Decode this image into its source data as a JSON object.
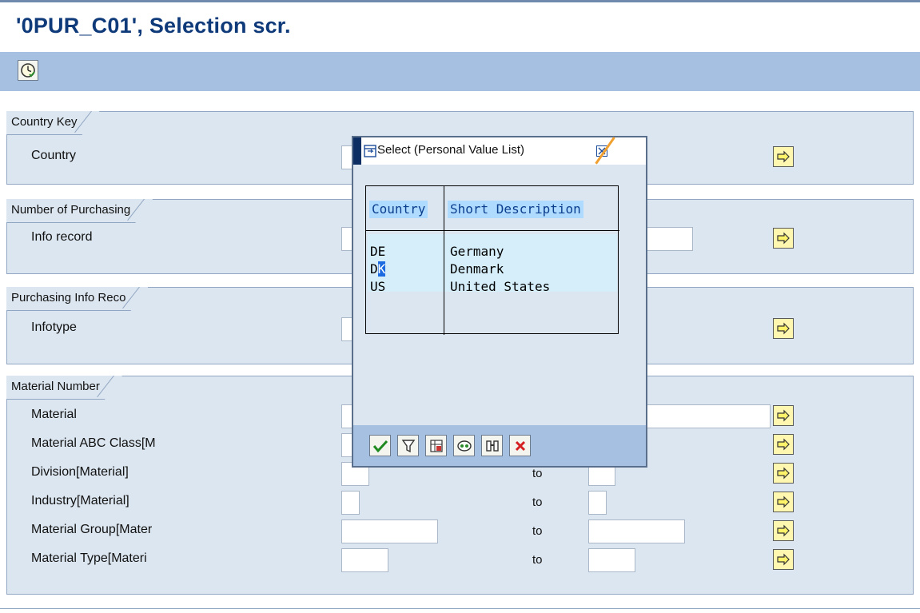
{
  "window": {
    "title": "'0PUR_C01', Selection scr."
  },
  "toolbar": {
    "execute_icon": "clock-execute-icon"
  },
  "groups": [
    {
      "title": "Country Key",
      "rows": [
        {
          "label": "Country",
          "to": ""
        }
      ]
    },
    {
      "title": "Number of Purchasing",
      "rows": [
        {
          "label": "Info record",
          "to": ""
        }
      ]
    },
    {
      "title": "Purchasing Info Reco",
      "rows": [
        {
          "label": "Infotype",
          "to": ""
        }
      ]
    },
    {
      "title": "Material Number",
      "rows": [
        {
          "label": "Material",
          "to": ""
        },
        {
          "label": "Material ABC Class[M",
          "to": ""
        },
        {
          "label": "Division[Material]",
          "to": "to"
        },
        {
          "label": "Industry[Material]",
          "to": "to"
        },
        {
          "label": "Material Group[Mater",
          "to": "to"
        },
        {
          "label": "Material Type[Materi",
          "to": "to"
        }
      ]
    }
  ],
  "popup": {
    "title": "Select (Personal Value List)",
    "columns": [
      "Country",
      "Short Description"
    ],
    "rows": [
      {
        "country": "DE",
        "description": "Germany"
      },
      {
        "country_prefix": "D",
        "country_cursor": "K",
        "description": "Denmark"
      },
      {
        "country": "US",
        "description": "United States"
      }
    ],
    "toolbar_icons": [
      "checkmark-icon",
      "filter-icon",
      "table-settings-icon",
      "personal-list-icon",
      "find-icon",
      "cancel-icon"
    ]
  },
  "colors": {
    "title_text": "#0f3a7a",
    "toolbar_bg": "#a6c0e2",
    "group_bg": "#dce6f0",
    "highlight": "#aedbff",
    "multiple_selection_button": "#fff7b0"
  }
}
